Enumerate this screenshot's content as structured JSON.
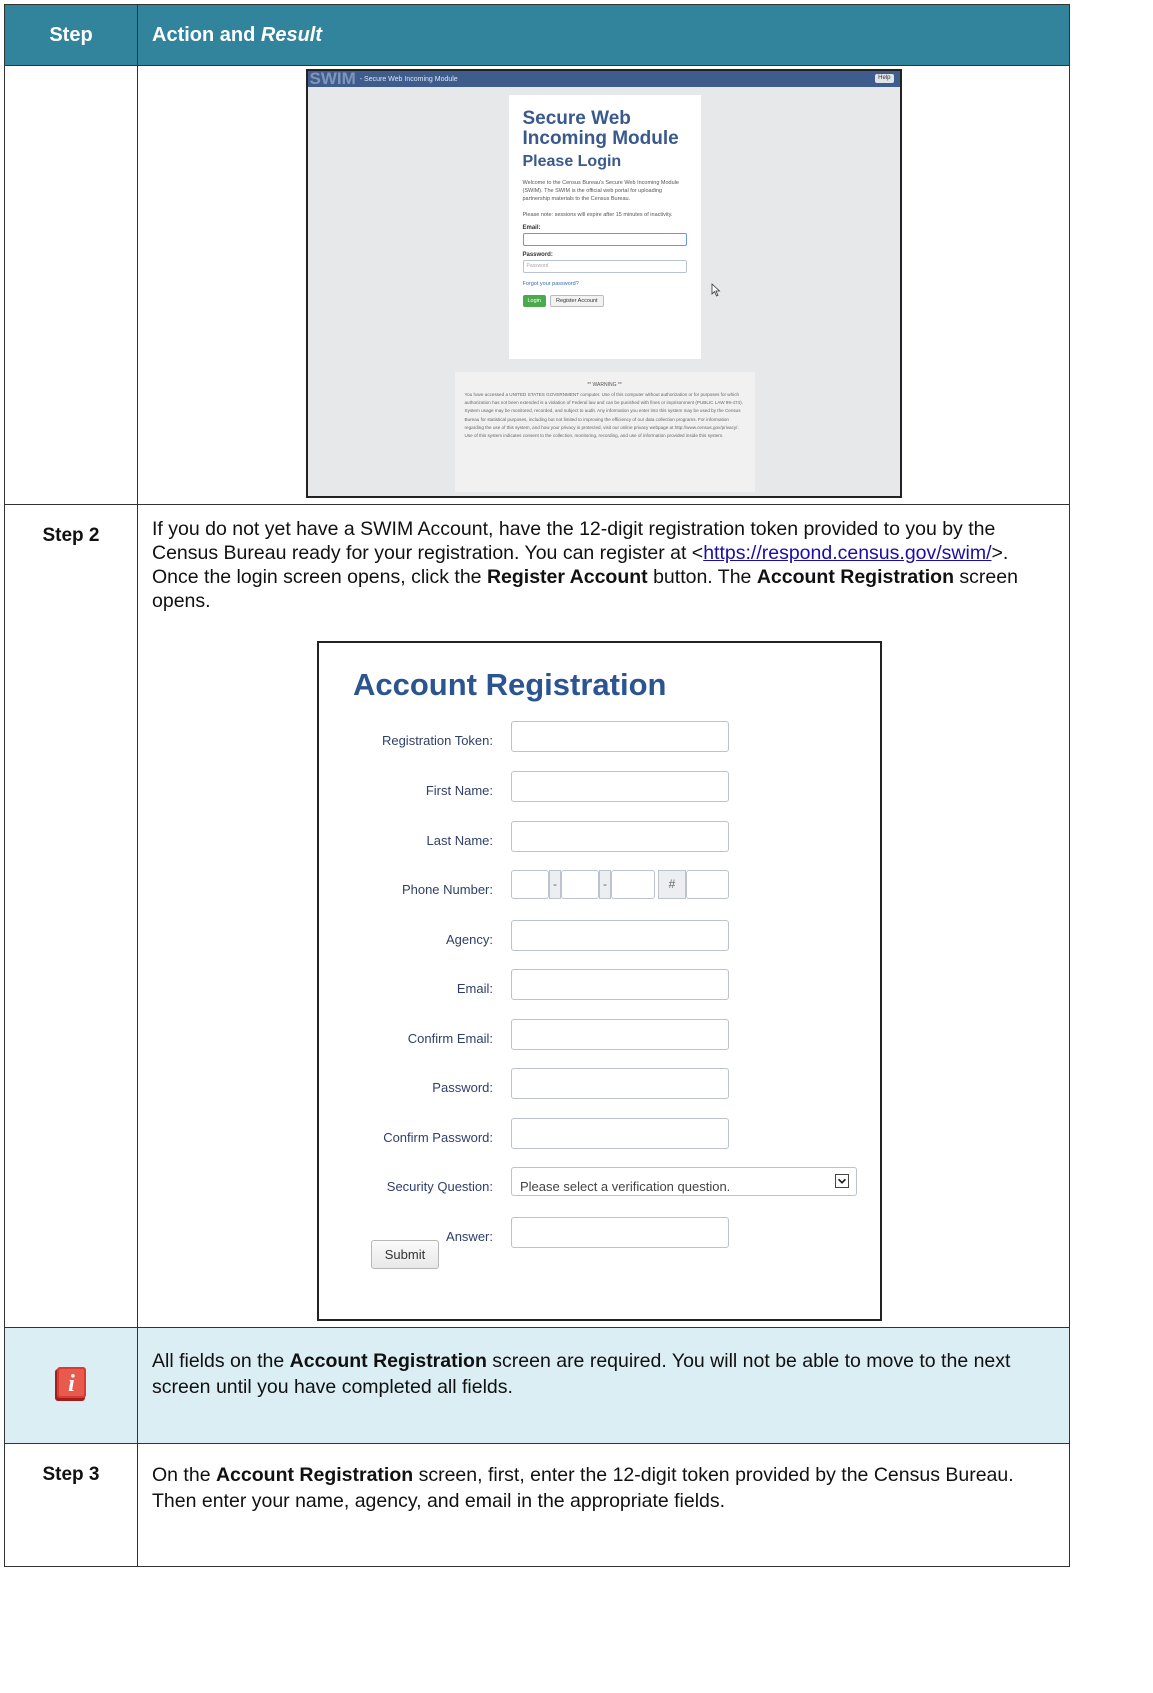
{
  "header": {
    "step": "Step",
    "action": "Action and ",
    "action_em": "Result"
  },
  "swim": {
    "logo": "SWIM",
    "bar_title": "- Secure Web Incoming Module",
    "help": "Help",
    "title_line1": "Secure Web",
    "title_line2": "Incoming Module",
    "subtitle": "Please Login",
    "welcome": "Welcome to the Census Bureau's Secure Web Incoming Module (SWIM). The SWIM is the official web portal for uploading partnership materials to the Census Bureau.",
    "note": "Please note: sessions will expire after 15 minutes of inactivity.",
    "email_label": "Email:",
    "password_label": "Password:",
    "password_placeholder": "Password",
    "forgot": "Forgot your password?",
    "login_btn": "Login",
    "register_btn": "Register Account",
    "warning_title": "** WARNING **",
    "warning_text": "You have accessed a UNITED STATES GOVERNMENT computer. Use of this computer without authorization or for purposes for which authorization has not been extended is a violation of Federal law and can be punished with fines or imprisonment (PUBLIC LAW 99-474). System usage may be monitored, recorded, and subject to audit. Any information you enter into this system may be used by the Census Bureau for statistical purposes, including but not limited to improving the efficiency of our data collection programs. For information regarding the use of this system, and how your privacy is protected, visit our online privacy webpage at http://www.census.gov/privacy/. Use of this system indicates consent to the collection, monitoring, recording, and use of information provided inside this system."
  },
  "step2": {
    "label": "Step 2",
    "text1": "If you do not yet have a SWIM Account, have the 12-digit registration token provided to you by the Census Bureau ready for your registration. You can register at <",
    "link": "https://respond.census.gov/swim/",
    "text2": ">. Once the login screen opens, click the ",
    "bold1": "Register Account",
    "text3": " button. The ",
    "bold2": "Account Registration",
    "text4": " screen opens."
  },
  "registration": {
    "title": "Account Registration",
    "fields": {
      "token": "Registration Token:",
      "first": "First Name:",
      "last": "Last Name:",
      "phone": "Phone Number:",
      "agency": "Agency:",
      "email": "Email:",
      "confirm_email": "Confirm Email:",
      "password": "Password:",
      "confirm_password": "Confirm Password:",
      "security": "Security Question:",
      "answer": "Answer:"
    },
    "phone_dash": "-",
    "phone_ext": "#",
    "security_placeholder": "Please select a verification question.",
    "submit": "Submit"
  },
  "note": {
    "text1": "All fields on the ",
    "bold": "Account Registration",
    "text2": " screen are required. You will not be able to move to the next screen until you have completed all fields."
  },
  "step3": {
    "label": "Step 3",
    "text1": "On the ",
    "bold": "Account Registration",
    "text2": " screen, first, enter the 12-digit token provided by the Census Bureau. Then enter your name, agency, and email in the appropriate fields."
  },
  "colors": {
    "header_bg": "#31849b",
    "note_bg": "#dbeef3",
    "title_blue": "#2b5490",
    "icon_red": "#cc2a2a"
  }
}
